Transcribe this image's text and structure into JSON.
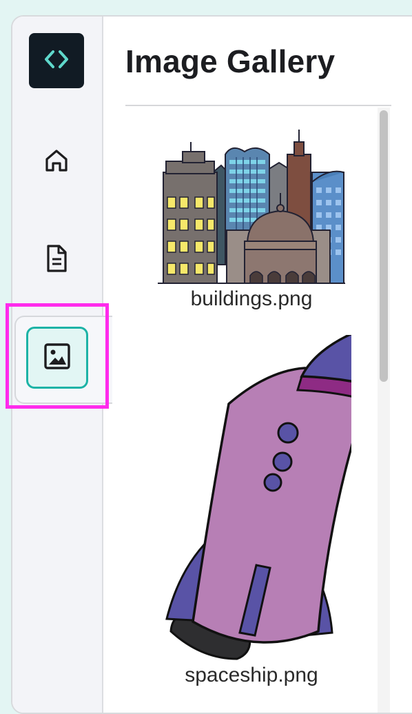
{
  "app": {
    "logo_icon": "code-brackets-icon",
    "accent_color": "#1cb3a6",
    "highlight_color": "#ff2bec"
  },
  "sidebar": {
    "items": [
      {
        "icon": "home-icon"
      },
      {
        "icon": "document-icon"
      },
      {
        "icon": "image-icon",
        "active": true
      }
    ]
  },
  "main": {
    "title": "Image Gallery",
    "images": [
      {
        "caption": "buildings.png",
        "icon": "buildings-illustration"
      },
      {
        "caption": "spaceship.png",
        "icon": "spaceship-illustration"
      }
    ]
  }
}
